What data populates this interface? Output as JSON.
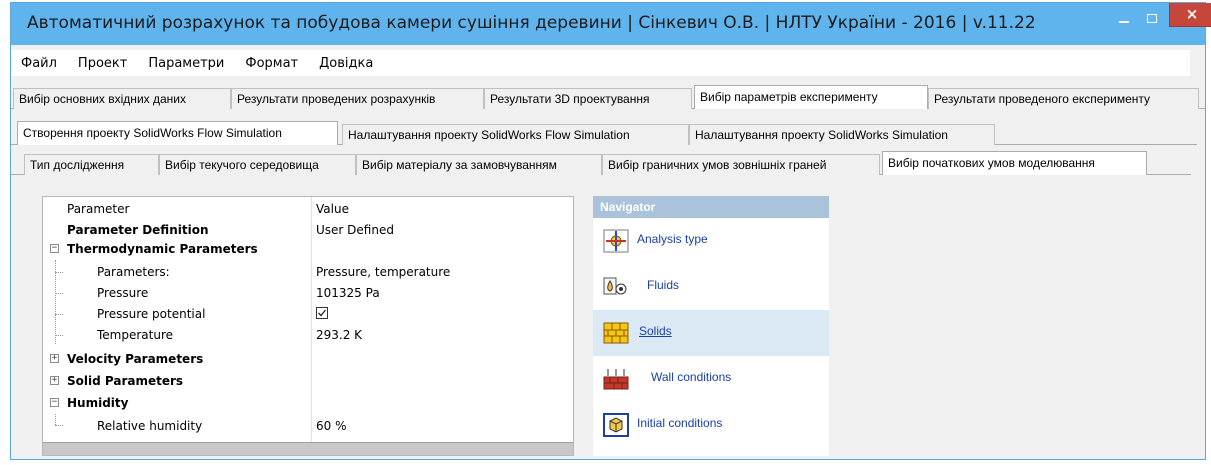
{
  "window": {
    "title": "Автоматичний розрахунок та побудова камери сушіння деревини | Сінкевич О.В. | НЛТУ України - 2016 | v.11.22"
  },
  "menu": [
    "Файл",
    "Проект",
    "Параметри",
    "Формат",
    "Довідка"
  ],
  "main_tabs": [
    {
      "label": "Вибір основних вхідних даних"
    },
    {
      "label": "Результати проведених розрахунків"
    },
    {
      "label": "Результати 3D проектування"
    },
    {
      "label": "Вибір параметрів експерименту"
    },
    {
      "label": "Результати проведеного експерименту"
    }
  ],
  "project_tabs": [
    {
      "label": "Створення проекту SolidWorks Flow Simulation"
    },
    {
      "label": "Налаштування проекту SolidWorks Flow Simulation"
    },
    {
      "label": "Налаштування проекту SolidWorks Simulation"
    }
  ],
  "sub_tabs": [
    {
      "label": "Тип дослідження"
    },
    {
      "label": "Вибір текучого середовища"
    },
    {
      "label": "Вибір матеріалу за замовчуванням"
    },
    {
      "label": "Вибір граничних умов зовнішніх граней"
    },
    {
      "label": "Вибір початкових умов моделювання"
    }
  ],
  "grid": {
    "col_parameter": "Parameter",
    "col_value": "Value",
    "rows": [
      {
        "label": "Parameter Definition",
        "value": "User Defined"
      },
      {
        "label": "Thermodynamic Parameters",
        "value": "",
        "expander": "minus"
      },
      {
        "label": "Parameters:",
        "value": "Pressure, temperature"
      },
      {
        "label": "Pressure",
        "value": "101325 Pa"
      },
      {
        "label": "Pressure potential",
        "value": "",
        "checked": true
      },
      {
        "label": "Temperature",
        "value": "293.2 K"
      },
      {
        "label": "Velocity Parameters",
        "value": "",
        "expander": "plus"
      },
      {
        "label": "Solid Parameters",
        "value": "",
        "expander": "plus"
      },
      {
        "label": "Humidity",
        "value": "",
        "expander": "minus"
      },
      {
        "label": "Relative humidity",
        "value": "60 %"
      }
    ]
  },
  "navigator": {
    "header": "Navigator",
    "items": [
      {
        "label": "Analysis type",
        "icon": "analysis-type-icon"
      },
      {
        "label": "Fluids",
        "icon": "fluids-icon"
      },
      {
        "label": "Solids",
        "icon": "solids-icon",
        "selected": true
      },
      {
        "label": "Wall conditions",
        "icon": "wall-conditions-icon"
      },
      {
        "label": "Initial conditions",
        "icon": "initial-conditions-icon"
      }
    ]
  },
  "glyphs": {
    "close": "×",
    "minus": "−",
    "plus": "+"
  },
  "colors": {
    "titlebar": "#5fb4ee",
    "close_button": "#c7463c",
    "navigator_header": "#aac3da",
    "link": "#1a3fa5"
  }
}
